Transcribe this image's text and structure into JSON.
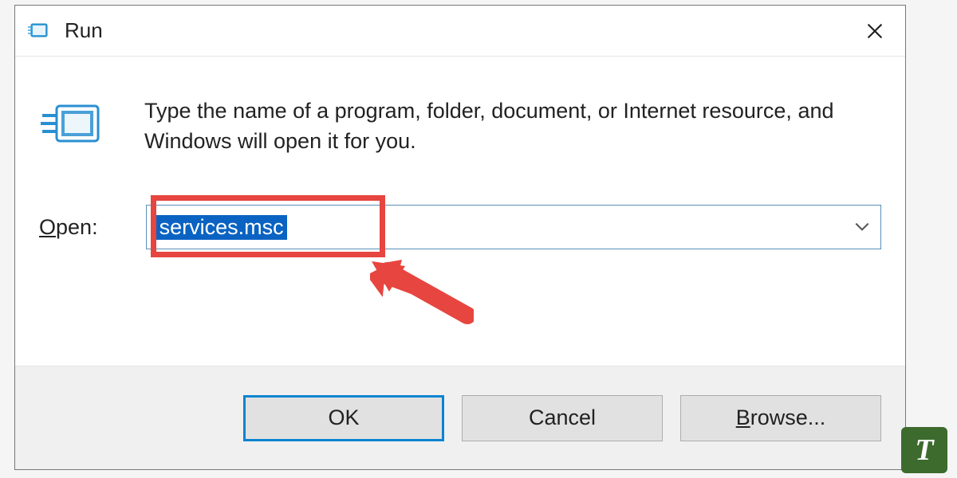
{
  "titlebar": {
    "title": "Run"
  },
  "body": {
    "description": "Type the name of a program, folder, document, or Internet resource, and Windows will open it for you.",
    "open_label_prefix": "O",
    "open_label_rest": "pen:",
    "input_value": "services.msc"
  },
  "buttons": {
    "ok": "OK",
    "cancel": "Cancel",
    "browse_prefix": "B",
    "browse_rest": "rowse..."
  },
  "watermark": "T"
}
